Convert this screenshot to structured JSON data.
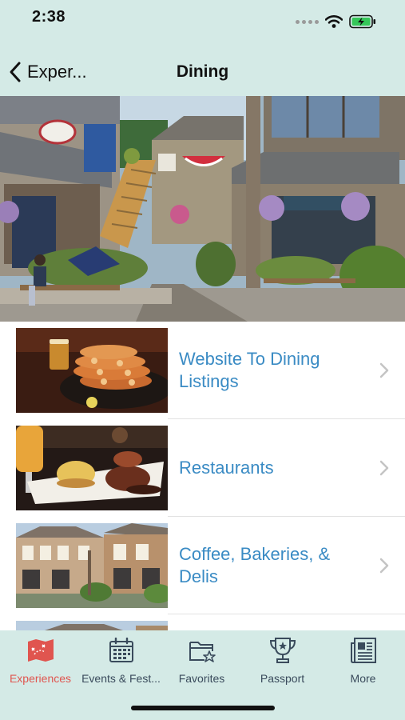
{
  "status": {
    "time": "2:38",
    "icons": [
      "signal-dots-icon",
      "wifi-icon",
      "battery-charging-icon"
    ],
    "battery_color": "#35c759"
  },
  "nav": {
    "back_label": "Exper...",
    "back_icon": "chevron-left-icon",
    "title": "Dining"
  },
  "hero": {
    "icon": "storefront-photo"
  },
  "list": {
    "items": [
      {
        "label": "Website To Dining Listings",
        "thumb": "crab-dinner-photo"
      },
      {
        "label": "Restaurants",
        "thumb": "eggs-benedict-photo"
      },
      {
        "label": "Coffee, Bakeries, & Delis",
        "thumb": "village-shops-photo"
      }
    ],
    "chevron_icon": "chevron-right-icon",
    "label_color": "#3a8bc4"
  },
  "tabs": [
    {
      "label": "Experiences",
      "icon": "map-icon",
      "active": true
    },
    {
      "label": "Events & Fest...",
      "icon": "calendar-icon",
      "active": false
    },
    {
      "label": "Favorites",
      "icon": "folder-star-icon",
      "active": false
    },
    {
      "label": "Passport",
      "icon": "trophy-icon",
      "active": false
    },
    {
      "label": "More",
      "icon": "newspaper-icon",
      "active": false
    }
  ],
  "colors": {
    "bar_background": "#d4eae6",
    "active_tab": "#e0554f",
    "inactive_tab": "#3a4b5c"
  }
}
